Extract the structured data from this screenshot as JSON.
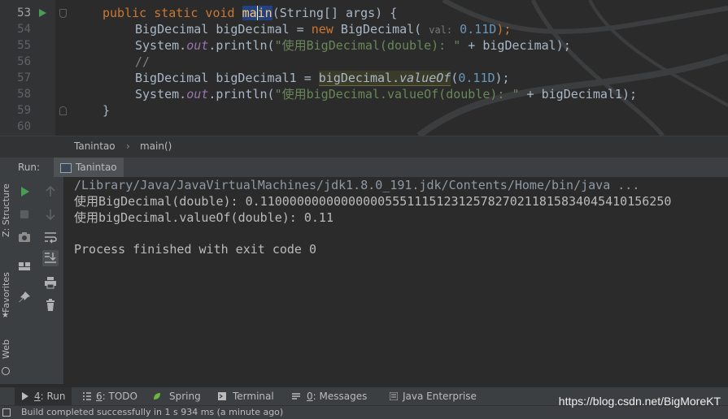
{
  "colors": {
    "editor_bg": "#2b2b2b",
    "keyword": "#cc7832",
    "number": "#6897bb",
    "string": "#6a8759",
    "comment": "#808080",
    "static_field": "#9876aa",
    "run_green": "#499c54"
  },
  "editor": {
    "line_numbers": [
      "53",
      "54",
      "55",
      "56",
      "57",
      "58",
      "59",
      "60"
    ],
    "lines": [
      {
        "kw": "public static void ",
        "name_pre": "ma",
        "name_post": "in",
        "rest": "(String[] args) {"
      },
      {
        "type": "BigDecimal bigDecimal = ",
        "kw": "new",
        "ctor": " BigDecimal( ",
        "hint": "val:",
        "num": " 0.11D",
        "end": ");"
      },
      {
        "pre": "System.",
        "field": "out",
        "call": ".println(",
        "str": "\"使用BigDecimal(double): \"",
        "end": " + bigDecimal);"
      },
      {
        "comment": "//"
      },
      {
        "pre": "BigDecimal bigDecimal1 = ",
        "usage": "bigDecimal.",
        "method": "valueOf",
        "paren": "(",
        "num": "0.11D",
        "end": ");"
      },
      {
        "pre": "System.",
        "field": "out",
        "call": ".println(",
        "str": "\"使用bigDecimal.valueOf(double): \"",
        "end": " + bigDecimal1);"
      },
      {
        "text": "}"
      },
      {
        "text": ""
      }
    ]
  },
  "breadcrumb": {
    "class": "Tanintao",
    "separator": "›",
    "method": "main()"
  },
  "run_panel": {
    "label": "Run:",
    "tab": "Tanintao"
  },
  "left_stripe": {
    "structure": "Z: Structure",
    "favorites": "Favorites",
    "web": "Web"
  },
  "console": {
    "lines": [
      "/Library/Java/JavaVirtualMachines/jdk1.8.0_191.jdk/Contents/Home/bin/java ...",
      "使用BigDecimal(double): 0.11000000000000000555111512312578270211815834045410156250",
      "使用bigDecimal.valueOf(double): 0.11",
      "",
      "Process finished with exit code 0"
    ]
  },
  "toolbar": {
    "rerun": "run-icon",
    "stop": "stop-icon",
    "screenshot": "camera-icon",
    "layout": "layout-icon",
    "pin": "pin-icon",
    "up": "arrow-up-icon",
    "down": "arrow-down-icon",
    "wrap": "soft-wrap-icon",
    "scroll_end": "scroll-to-end-icon",
    "print": "print-icon",
    "trash": "trash-icon"
  },
  "bottom_tabs": [
    {
      "num": "4",
      "label": ": Run"
    },
    {
      "num": "6",
      "label": ": TODO"
    },
    {
      "num": "",
      "label": "Spring"
    },
    {
      "num": "",
      "label": "Terminal"
    },
    {
      "num": "0",
      "label": ": Messages"
    },
    {
      "num": "",
      "label": "Java Enterprise"
    }
  ],
  "status": "Build completed successfully in 1 s 934 ms (a minute ago)",
  "watermark": "https://blog.csdn.net/BigMoreKT"
}
